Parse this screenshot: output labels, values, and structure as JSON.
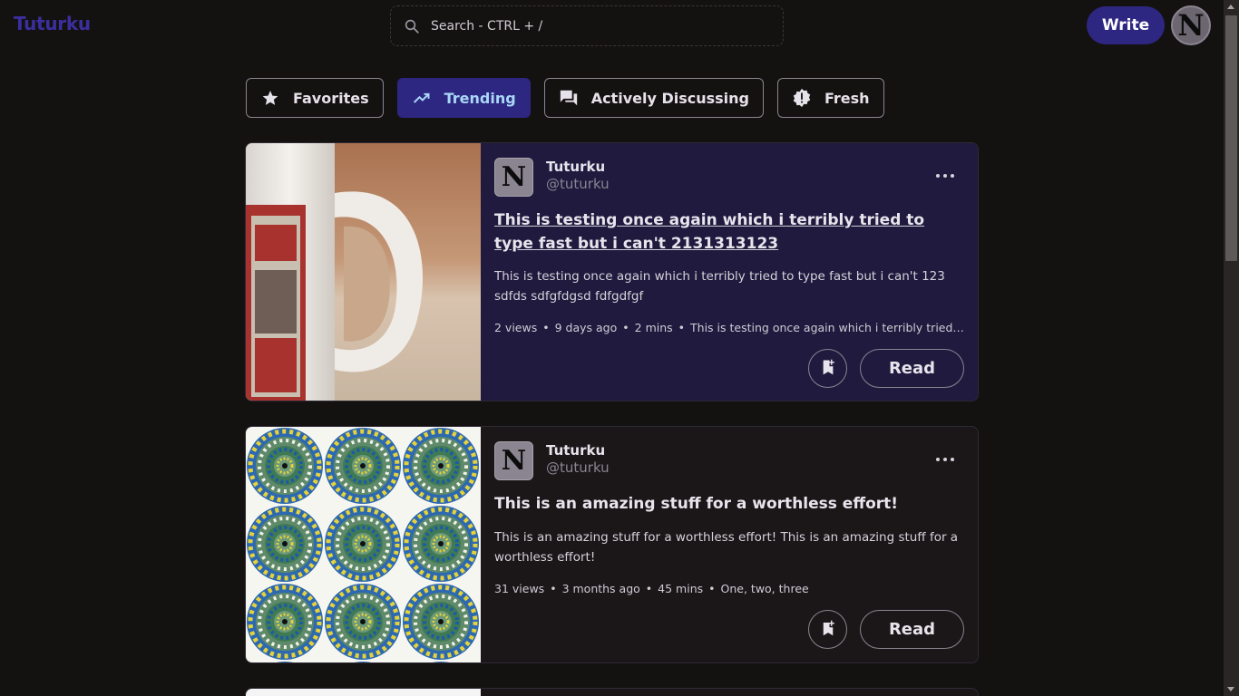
{
  "header": {
    "logo": "Tuturku",
    "search_placeholder": "Search - CTRL + /",
    "write_label": "Write",
    "avatar_letter": "N"
  },
  "tabs": [
    {
      "label": "Favorites",
      "icon": "star-icon",
      "active": false
    },
    {
      "label": "Trending",
      "icon": "trending-up-icon",
      "active": true
    },
    {
      "label": "Actively Discussing",
      "icon": "forum-icon",
      "active": false
    },
    {
      "label": "Fresh",
      "icon": "new-badge-icon",
      "active": false
    }
  ],
  "posts": [
    {
      "avatar_letter": "N",
      "author_name": "Tuturku",
      "author_handle": "@tuturku",
      "title": "This is testing once again which i terribly tried to type fast but i can't 2131313123",
      "excerpt": "This is testing once again which i terribly tried to type fast but i can't 123 sdfds sdfgfdgsd fdfgdfgf",
      "views": "2 views",
      "time": "9 days ago",
      "read_time": "2 mins",
      "tags": "This is testing once again which i terribly tried to type...",
      "read_label": "Read",
      "image": "coffee-mug-photo"
    },
    {
      "avatar_letter": "N",
      "author_name": "Tuturku",
      "author_handle": "@tuturku",
      "title": "This is an amazing stuff for a worthless effort!",
      "excerpt": "This is an amazing stuff for a worthless effort! This is an amazing stuff for a worthless effort!",
      "views": "31 views",
      "time": "3 months ago",
      "read_time": "45 mins",
      "tags": "One, two, three",
      "read_label": "Read",
      "image": "optical-illusion-circles"
    }
  ],
  "colors": {
    "background": "#141111",
    "accent": "#2e2782",
    "active_tab_text": "#a9d7f5",
    "card_highlight": "#1f1a3e"
  }
}
